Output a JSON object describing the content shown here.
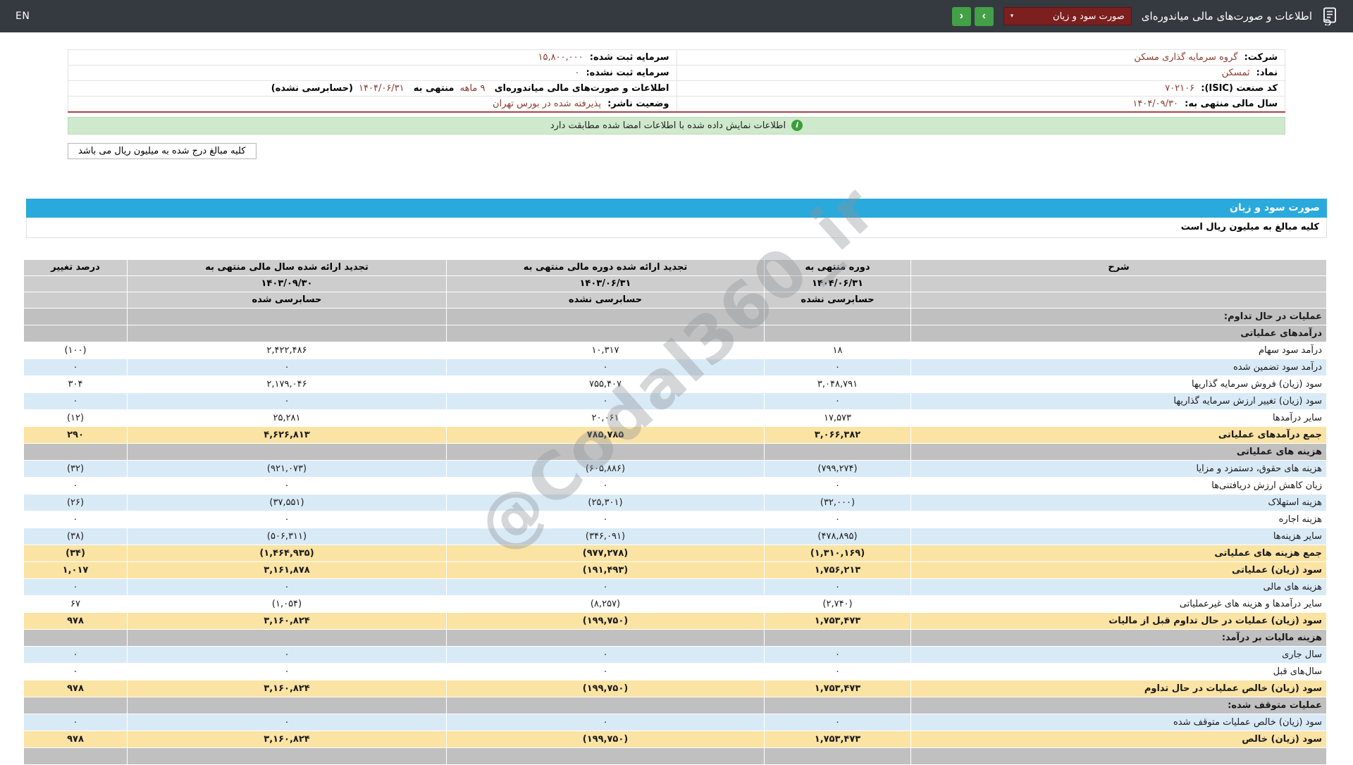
{
  "topbar": {
    "en_label": "EN",
    "title": "اطلاعات و صورت‌های مالی میاندوره‌ای",
    "report_select_value": "صورت سود و زیان",
    "select_caret": "▾",
    "nav_next_glyph": "›",
    "nav_prev_glyph": "‹"
  },
  "company": {
    "col_right": [
      {
        "label": "شرکت:",
        "value": "گروه سرمایه گذاری مسکن"
      },
      {
        "label": "نماد:",
        "value": "ثمسکن"
      },
      {
        "label": "کد صنعت (ISIC):",
        "value": "۷۰۲۱۰۶"
      },
      {
        "label": "سال مالی منتهی به:",
        "value": "۱۴۰۴/۰۹/۳۰"
      }
    ],
    "col_left": [
      {
        "label": "سرمایه ثبت شده:",
        "value": "۱۵,۸۰۰,۰۰۰"
      },
      {
        "label": "سرمایه ثبت نشده:",
        "value": "۰"
      },
      {
        "label": "وضعیت ناشر:",
        "value": "پذیرفته شده در بورس تهران"
      }
    ],
    "report_info": {
      "prefix": "اطلاعات و صورت‌های مالی میاندوره‌ای",
      "period": "۹ ماهه",
      "middle": "منتهی به",
      "date": "۱۴۰۴/۰۶/۳۱",
      "suffix": "(حسابرسی نشده)"
    }
  },
  "banner": {
    "icon": "i",
    "text": "اطلاعات نمایش داده شده با اطلاعات امضا شده مطابقت دارد"
  },
  "note": {
    "text": "کلیه مبالغ درج شده به میلیون ریال می باشد"
  },
  "statement": {
    "title": "صورت سود و زیان",
    "subtitle": "کلیه مبالغ به میلیون ریال است"
  },
  "table": {
    "header": {
      "desc": "شرح",
      "change": "درصد تغییر",
      "cols": [
        {
          "title": "دوره منتهی به",
          "date": "۱۴۰۴/۰۶/۳۱",
          "audit": "حسابرسی نشده"
        },
        {
          "title": "تجدید ارائه شده دوره مالی منتهی به",
          "date": "۱۴۰۳/۰۶/۳۱",
          "audit": "حسابرسی نشده"
        },
        {
          "title": "تجدید ارائه شده سال مالی منتهی به",
          "date": "۱۴۰۳/۰۹/۳۰",
          "audit": "حسابرسی شده"
        }
      ]
    },
    "rows": [
      {
        "type": "section",
        "label": "عملیات در حال تداوم:"
      },
      {
        "type": "section",
        "label": "درآمدهای عملیاتی"
      },
      {
        "type": "data",
        "shade": "white",
        "label": "درآمد سود سهام",
        "values": [
          "۱۸",
          "۱۰,۳۱۷",
          "۲,۴۲۲,۴۸۶",
          "(۱۰۰)"
        ]
      },
      {
        "type": "data",
        "shade": "blue",
        "label": "درآمد سود تضمین شده",
        "values": [
          "۰",
          "۰",
          "۰",
          "۰"
        ]
      },
      {
        "type": "data",
        "shade": "white",
        "label": "سود (زیان) فروش سرمایه گذاریها",
        "values": [
          "۳,۰۴۸,۷۹۱",
          "۷۵۵,۴۰۷",
          "۲,۱۷۹,۰۴۶",
          "۳۰۴"
        ]
      },
      {
        "type": "data",
        "shade": "blue",
        "label": "سود (زیان) تغییر ارزش سرمایه گذاریها",
        "values": [
          "۰",
          "۰",
          "۰",
          "۰"
        ]
      },
      {
        "type": "data",
        "shade": "white",
        "label": "سایر درآمدها",
        "values": [
          "۱۷,۵۷۳",
          "۲۰,۰۶۱",
          "۲۵,۲۸۱",
          "(۱۲)"
        ]
      },
      {
        "type": "data",
        "shade": "yellow",
        "label": "جمع درآمدهای عملیاتی",
        "values": [
          "۳,۰۶۶,۳۸۲",
          "۷۸۵,۷۸۵",
          "۴,۶۲۶,۸۱۳",
          "۲۹۰"
        ]
      },
      {
        "type": "section",
        "label": "هزینه های عملیاتی"
      },
      {
        "type": "data",
        "shade": "blue",
        "label": "هزینه های حقوق، دستمزد و مزایا",
        "values": [
          "(۷۹۹,۲۷۴)",
          "(۶۰۵,۸۸۶)",
          "(۹۲۱,۰۷۳)",
          "(۳۲)"
        ]
      },
      {
        "type": "data",
        "shade": "white",
        "label": "زیان کاهش ارزش دریافتنی‌ها",
        "values": [
          "۰",
          "۰",
          "۰",
          "۰"
        ]
      },
      {
        "type": "data",
        "shade": "blue",
        "label": "هزینه استهلاک",
        "values": [
          "(۳۲,۰۰۰)",
          "(۲۵,۳۰۱)",
          "(۳۷,۵۵۱)",
          "(۲۶)"
        ]
      },
      {
        "type": "data",
        "shade": "white",
        "label": "هزینه اجاره",
        "values": [
          "۰",
          "۰",
          "۰",
          "۰"
        ]
      },
      {
        "type": "data",
        "shade": "blue",
        "label": "سایر هزینه‌ها",
        "values": [
          "(۴۷۸,۸۹۵)",
          "(۳۴۶,۰۹۱)",
          "(۵۰۶,۳۱۱)",
          "(۳۸)"
        ]
      },
      {
        "type": "data",
        "shade": "yellow",
        "label": "جمع هزینه های عملیاتی",
        "values": [
          "(۱,۳۱۰,۱۶۹)",
          "(۹۷۷,۲۷۸)",
          "(۱,۴۶۴,۹۳۵)",
          "(۳۴)"
        ]
      },
      {
        "type": "data",
        "shade": "yellow",
        "label": "سود (زیان) عملیاتی",
        "values": [
          "۱,۷۵۶,۲۱۳",
          "(۱۹۱,۴۹۳)",
          "۳,۱۶۱,۸۷۸",
          "۱,۰۱۷"
        ]
      },
      {
        "type": "data",
        "shade": "blue",
        "label": "هزینه های مالی",
        "values": [
          "۰",
          "۰",
          "۰",
          "۰"
        ]
      },
      {
        "type": "data",
        "shade": "white",
        "label": "سایر درآمدها و هزینه های غیرعملیاتی",
        "values": [
          "(۲,۷۴۰)",
          "(۸,۲۵۷)",
          "(۱,۰۵۴)",
          "۶۷"
        ]
      },
      {
        "type": "data",
        "shade": "yellow",
        "label": "سود (زیان) عملیات در حال تداوم قبل از مالیات",
        "values": [
          "۱,۷۵۳,۴۷۳",
          "(۱۹۹,۷۵۰)",
          "۳,۱۶۰,۸۲۴",
          "۹۷۸"
        ]
      },
      {
        "type": "section",
        "label": "هزینه مالیات بر درآمد:"
      },
      {
        "type": "data",
        "shade": "blue",
        "label": "سال جاری",
        "values": [
          "۰",
          "۰",
          "۰",
          "۰"
        ]
      },
      {
        "type": "data",
        "shade": "white",
        "label": "سال‌های قبل",
        "values": [
          "۰",
          "۰",
          "۰",
          "۰"
        ]
      },
      {
        "type": "data",
        "shade": "yellow",
        "label": "سود (زیان) خالص عملیات در حال تداوم",
        "values": [
          "۱,۷۵۳,۴۷۳",
          "(۱۹۹,۷۵۰)",
          "۳,۱۶۰,۸۲۴",
          "۹۷۸"
        ]
      },
      {
        "type": "section",
        "label": "عملیات متوقف شده:"
      },
      {
        "type": "data",
        "shade": "blue",
        "label": "سود (زیان) خالص عملیات متوقف شده",
        "values": [
          "۰",
          "۰",
          "۰",
          "۰"
        ]
      },
      {
        "type": "data",
        "shade": "yellow",
        "label": "سود (زیان) خالص",
        "values": [
          "۱,۷۵۳,۴۷۳",
          "(۱۹۹,۷۵۰)",
          "۳,۱۶۰,۸۲۴",
          "۹۷۸"
        ]
      },
      {
        "type": "section",
        "label": ""
      }
    ]
  },
  "watermark": {
    "text": "@Codal360_ir"
  },
  "colors": {
    "topbar_bg": "#343a40",
    "select_maroon": "#7b1f1f",
    "nav_green": "#43a047",
    "banner_bg": "#cfe9cc",
    "banner_icon": "#3a9e3a",
    "title_cyan": "#2aa9dc",
    "row_blue": "#d9eaf7",
    "row_yellow": "#fbe3a3",
    "row_gray": "#c0c0c0",
    "header_gray": "#cdcdcd",
    "neg_red": "#c0392b",
    "value_maroon": "#8b3a2e"
  }
}
